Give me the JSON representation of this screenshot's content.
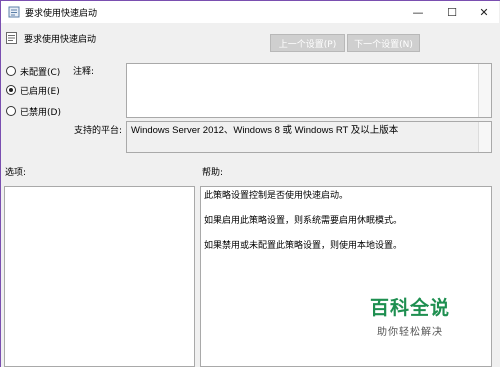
{
  "window": {
    "title": "要求使用快速启动",
    "minimize_glyph": "—",
    "maximize_glyph": "☐",
    "close_glyph": "✕"
  },
  "policy": {
    "name": "要求使用快速启动",
    "prev_button": "上一个设置(P)",
    "next_button": "下一个设置(N)"
  },
  "state": {
    "options": [
      {
        "label": "未配置(C)",
        "checked": false
      },
      {
        "label": "已启用(E)",
        "checked": true
      },
      {
        "label": "已禁用(D)",
        "checked": false
      }
    ]
  },
  "comment": {
    "label": "注释:",
    "value": ""
  },
  "supported": {
    "label": "支持的平台:",
    "value": "Windows Server 2012、Windows 8 或 Windows RT 及以上版本"
  },
  "options_pane": {
    "label": "选项:"
  },
  "help_pane": {
    "label": "帮助:",
    "paragraphs": [
      "此策略设置控制是否使用快速启动。",
      "如果启用此策略设置，则系统需要启用休眠模式。",
      "如果禁用或未配置此策略设置，则使用本地设置。"
    ]
  },
  "watermark": {
    "main": "百科全说",
    "sub": "助你轻松解决"
  },
  "colors": {
    "accent_border": "#7a4fb0",
    "watermark_green": "#1e8f50"
  }
}
